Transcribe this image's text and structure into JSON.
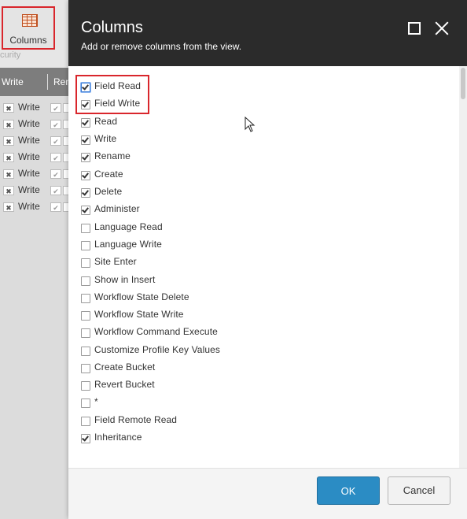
{
  "background": {
    "columns_button_label": "Columns",
    "security_label": "curity",
    "header_col1": "Write",
    "header_col2": "Ren",
    "row_label": "Write",
    "row_count": 7
  },
  "dialog": {
    "title": "Columns",
    "subtitle": "Add or remove columns from the view.",
    "options": [
      {
        "label": "Field Read",
        "checked": true
      },
      {
        "label": "Field Write",
        "checked": true
      },
      {
        "label": "Read",
        "checked": true
      },
      {
        "label": "Write",
        "checked": true
      },
      {
        "label": "Rename",
        "checked": true
      },
      {
        "label": "Create",
        "checked": true
      },
      {
        "label": "Delete",
        "checked": true
      },
      {
        "label": "Administer",
        "checked": true
      },
      {
        "label": "Language Read",
        "checked": false
      },
      {
        "label": "Language Write",
        "checked": false
      },
      {
        "label": "Site Enter",
        "checked": false
      },
      {
        "label": "Show in Insert",
        "checked": false
      },
      {
        "label": "Workflow State Delete",
        "checked": false
      },
      {
        "label": "Workflow State Write",
        "checked": false
      },
      {
        "label": "Workflow Command Execute",
        "checked": false
      },
      {
        "label": "Customize Profile Key Values",
        "checked": false
      },
      {
        "label": "Create Bucket",
        "checked": false
      },
      {
        "label": "Revert Bucket",
        "checked": false
      },
      {
        "label": "*",
        "checked": false
      },
      {
        "label": "Field Remote Read",
        "checked": false
      },
      {
        "label": "Inheritance",
        "checked": true
      }
    ],
    "ok_label": "OK",
    "cancel_label": "Cancel"
  },
  "colors": {
    "header_bg": "#2b2b2b",
    "ok_button": "#2b8cc4",
    "highlight": "#d9262c"
  }
}
